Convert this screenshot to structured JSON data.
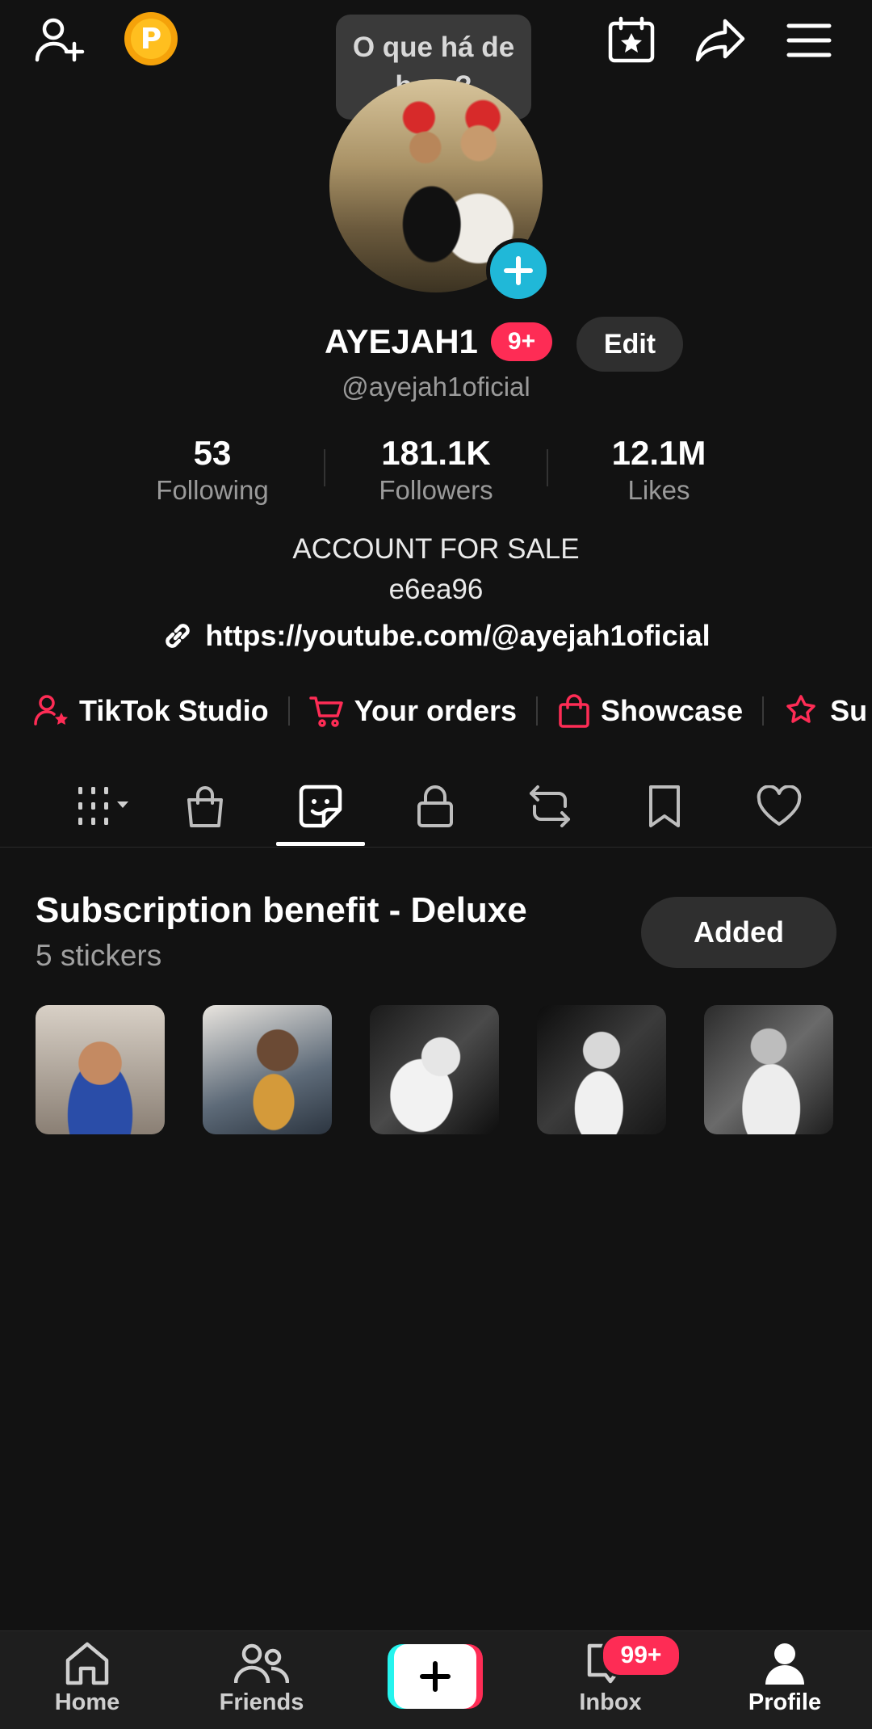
{
  "tooltip": {
    "text": "O que há de bom?"
  },
  "profile": {
    "display_name": "AYEJAH1",
    "name_badge": "9+",
    "edit_label": "Edit",
    "handle": "@ayejah1oficial",
    "bio_line1": "ACCOUNT FOR SALE",
    "bio_line2": "e6ea96",
    "link": "https://youtube.com/@ayejah1oficial"
  },
  "stats": [
    {
      "value": "53",
      "label": "Following"
    },
    {
      "value": "181.1K",
      "label": "Followers"
    },
    {
      "value": "12.1M",
      "label": "Likes"
    }
  ],
  "shortcuts": [
    {
      "label": "TikTok Studio",
      "icon": "person-star-icon"
    },
    {
      "label": "Your orders",
      "icon": "cart-icon"
    },
    {
      "label": "Showcase",
      "icon": "shopping-bag-icon"
    },
    {
      "label": "Su",
      "icon": "sparkle-icon"
    }
  ],
  "content_tabs": [
    {
      "icon": "grid-icon",
      "active": false
    },
    {
      "icon": "shopping-bag-icon",
      "active": false
    },
    {
      "icon": "sticker-icon",
      "active": true
    },
    {
      "icon": "lock-icon",
      "active": false
    },
    {
      "icon": "repost-icon",
      "active": false
    },
    {
      "icon": "bookmark-icon",
      "active": false
    },
    {
      "icon": "heart-icon",
      "active": false
    }
  ],
  "subscription": {
    "title": "Subscription benefit - Deluxe",
    "subtitle": "5 stickers",
    "button_label": "Added"
  },
  "nav": {
    "home": "Home",
    "friends": "Friends",
    "inbox": "Inbox",
    "inbox_badge": "99+",
    "profile": "Profile"
  },
  "colors": {
    "accent_red": "#fe2c55",
    "accent_cyan": "#25f4ee",
    "coin": "#f5a20a",
    "background": "#121212"
  }
}
